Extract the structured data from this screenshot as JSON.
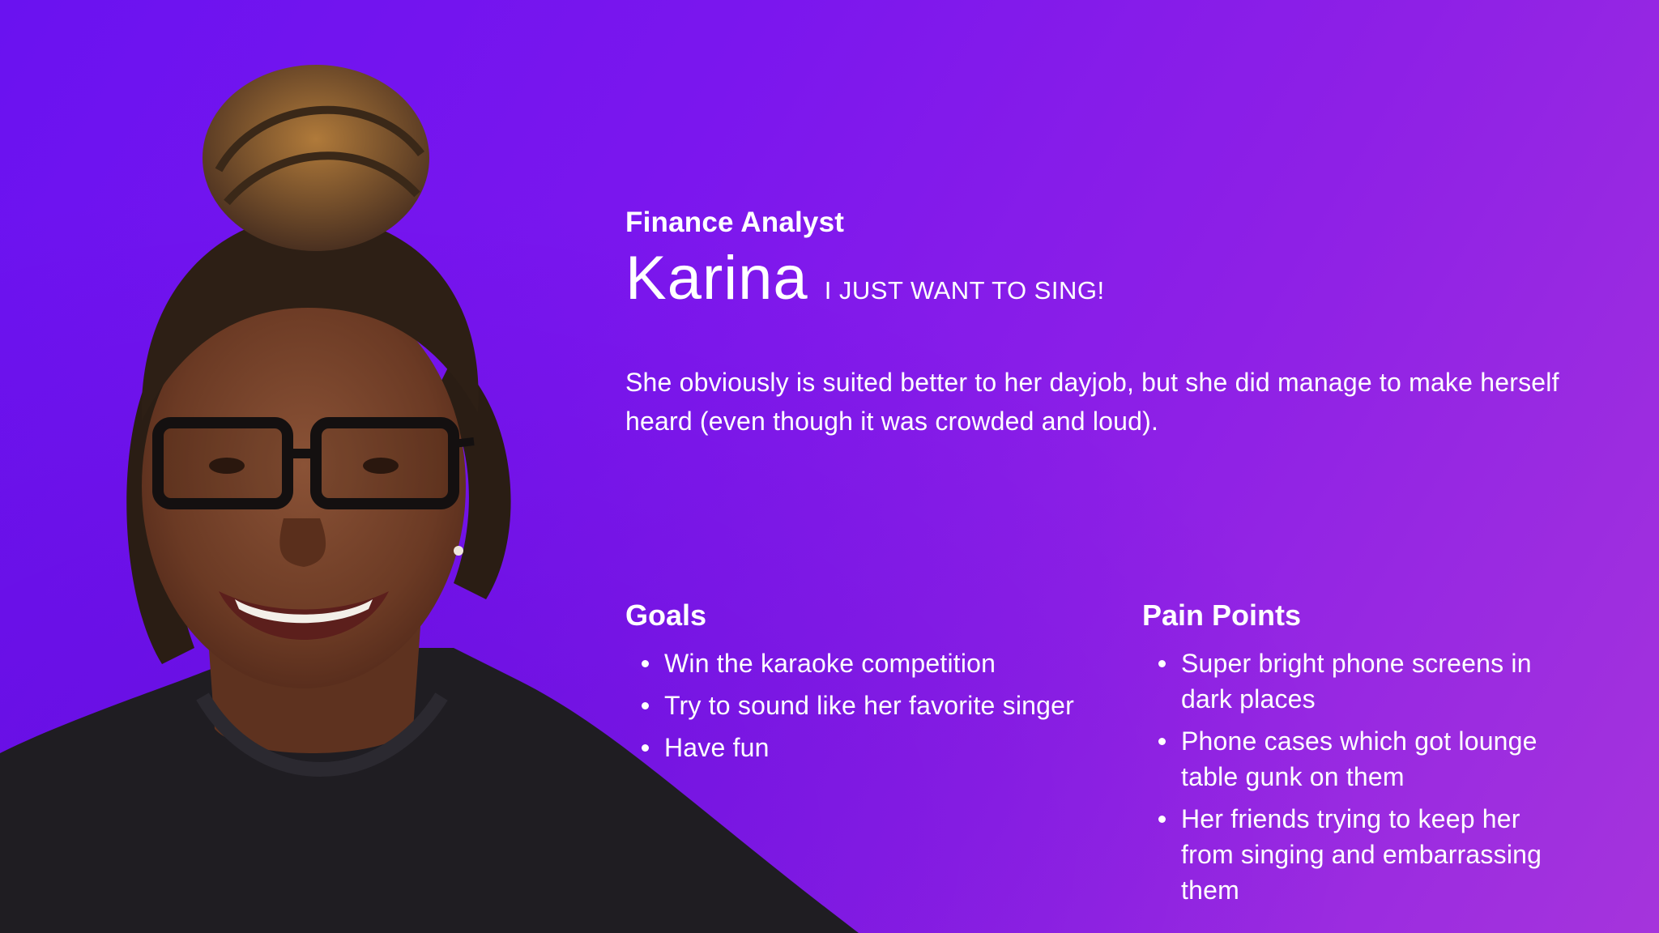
{
  "persona": {
    "role": "Finance Analyst",
    "name": "Karina",
    "quote": "I JUST WANT TO SING!",
    "bio": "She obviously is suited better to her dayjob, but she did manage to make herself heard (even though it was crowded and loud)."
  },
  "goals": {
    "heading": "Goals",
    "items": [
      "Win the karaoke competition",
      "Try to sound like her favorite singer",
      "Have fun"
    ]
  },
  "pain_points": {
    "heading": "Pain Points",
    "items": [
      "Super bright phone screens in dark places",
      "Phone cases which got lounge table gunk on them",
      "Her friends trying to keep her from singing and embarrassing them"
    ]
  },
  "colors": {
    "background_start": "#6a12f0",
    "background_end": "#a534dc",
    "text": "#ffffff"
  },
  "image": {
    "subject": "portrait-photo"
  }
}
